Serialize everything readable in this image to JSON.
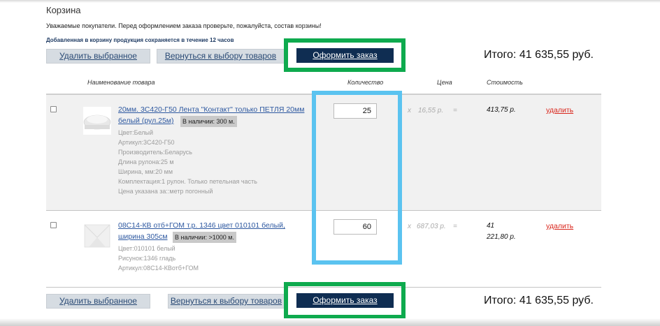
{
  "page": {
    "title": "Корзина",
    "notice": "Уважаемые покупатели. Перед оформлением заказа проверьте, пожалуйста, состав корзины!",
    "keep_note": "Добавленная в корзину продукция сохраняется в течение 12 часов"
  },
  "actions": {
    "delete_selected": "Удалить выбранное",
    "back_to_goods": "Вернуться к выбору товаров",
    "checkout": "Оформить заказ"
  },
  "total_text": "Итого: 41 635,55 руб.",
  "columns": {
    "name": "Наименование товара",
    "quantity": "Количество",
    "price": "Цена",
    "cost": "Стоимость"
  },
  "items": [
    {
      "name": "20мм. 3С420-Г50 Лента \"Контакт\" только ПЕТЛЯ 20мм белый (рул.25м)",
      "stock": "В наличии: 300 м.",
      "props": [
        "Цвет:Белый",
        "Артикул:3С420-Г50",
        "Производитель:Беларусь",
        "Длина рулона:25 м",
        "Ширина, мм:20 мм",
        "Комплектация:1 рулон. Только петельная часть",
        "Цена указана за::метр погонный"
      ],
      "quantity": "25",
      "times": "x",
      "price": "16,55 р.",
      "equals": "=",
      "cost": "413,75 р.",
      "delete": "удалить"
    },
    {
      "name": "08С14-КВ отб+ГОМ т.р. 1346 цвет 010101 белый, ширина 305см",
      "stock": "В наличии: >1000 м.",
      "props": [
        "Цвет:010101 белый",
        "Рисунок:1346 гладь",
        "Артикул:08С14-КВотб+ГОМ"
      ],
      "quantity": "60",
      "times": "x",
      "price": "687,03 р.",
      "equals": "=",
      "cost_line1": "41",
      "cost_line2": "221,80 р.",
      "delete": "удалить"
    }
  ],
  "colors": {
    "accent_dark": "#0f2d52",
    "highlight_green": "#0eaa4e",
    "highlight_blue": "#5bc3f0",
    "delete_red": "#d9261c",
    "link_blue": "#2d58a0"
  }
}
